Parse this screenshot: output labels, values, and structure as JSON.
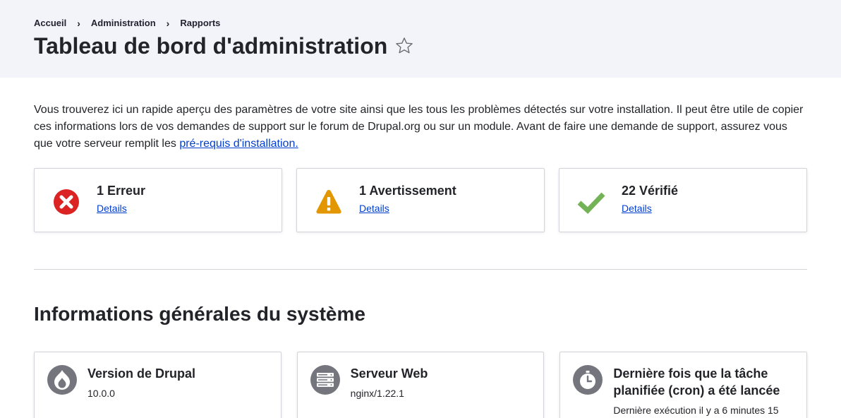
{
  "breadcrumb": {
    "items": [
      "Accueil",
      "Administration",
      "Rapports"
    ],
    "separator": "›"
  },
  "page": {
    "title": "Tableau de bord d'administration"
  },
  "intro": {
    "text": "Vous trouverez ici un rapide aperçu des paramètres de votre site ainsi que les tous les problèmes détectés sur votre installation. Il peut être utile de copier ces informations lors de vos demandes de support sur le forum de Drupal.org ou sur un module. Avant de faire une demande de support, assurez vous que votre serveur remplit les ",
    "link": "pré-requis d'installation."
  },
  "status": {
    "error": {
      "title": "1 Erreur",
      "link": "Details",
      "icon": "error-x-icon",
      "color": "#dc2323"
    },
    "warning": {
      "title": "1 Avertissement",
      "link": "Details",
      "icon": "warning-triangle-icon",
      "color": "#e29700"
    },
    "checked": {
      "title": "22 Vérifié",
      "link": "Details",
      "icon": "checkmark-icon",
      "color": "#73b355"
    }
  },
  "system": {
    "section_title": "Informations générales du système",
    "cards": [
      {
        "title": "Version de Drupal",
        "value": "10.0.0",
        "icon": "drupal-drop-icon"
      },
      {
        "title": "Serveur Web",
        "value": "nginx/1.22.1",
        "icon": "server-icon"
      },
      {
        "title": "Dernière fois que la tâche planifiée (cron) a été lancée",
        "value": "Dernière exécution il y a 6 minutes 15",
        "icon": "timer-icon"
      }
    ]
  }
}
